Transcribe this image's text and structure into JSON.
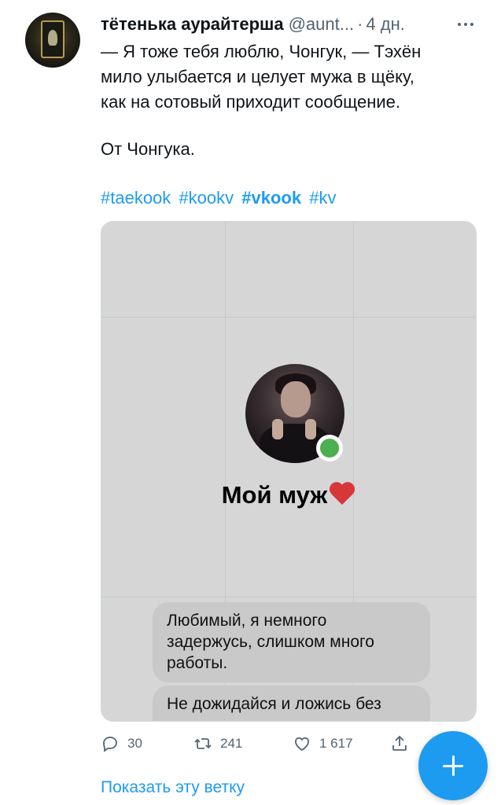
{
  "tweet": {
    "author_name": "тётенька аурайтерша",
    "author_handle": "@aunt...",
    "separator": "·",
    "time": "4 дн.",
    "text_lines": [
      "— Я тоже тебя люблю, Чонгук, — Тэхён",
      "мило улыбается и целует мужа в щёку,",
      "как на сотовый приходит сообщение."
    ],
    "text_line2": "От Чонгука.",
    "hashtags": [
      "#taekook",
      "#kookv",
      "#vkook",
      "#kv"
    ]
  },
  "media": {
    "contact_name": "Мой муж",
    "messages": [
      "Любимый, я немного задержусь, слишком много работы.",
      "Не дожидайся и ложись без"
    ]
  },
  "actions": {
    "replies": "30",
    "retweets": "241",
    "likes": "1 617"
  },
  "show_thread": "Показать эту ветку",
  "colors": {
    "accent": "#1d9bf0",
    "online": "#4caf50",
    "heart": "#d8373a"
  }
}
